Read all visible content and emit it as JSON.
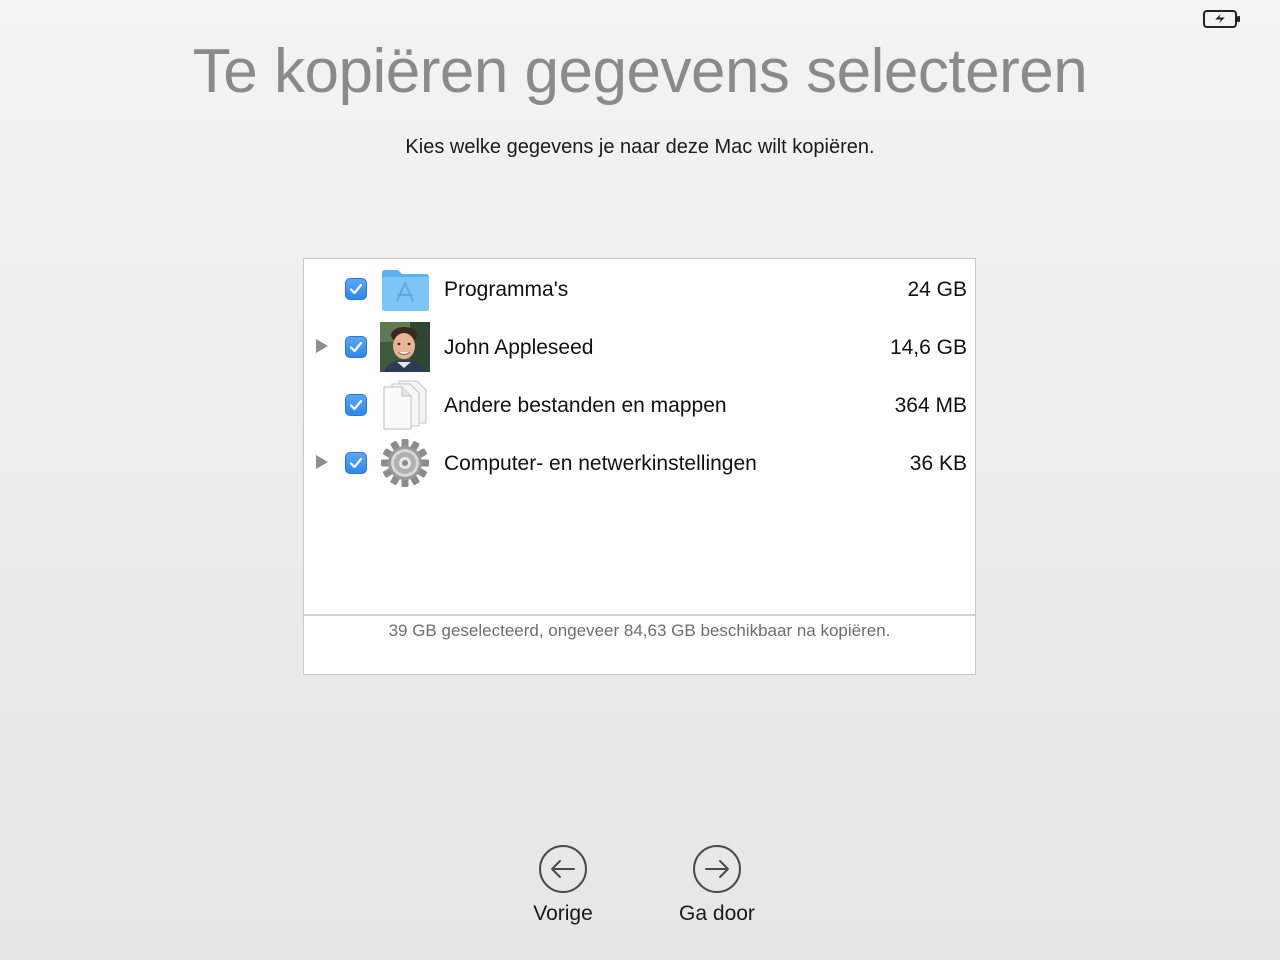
{
  "header": {
    "title": "Te kopiëren gegevens selecteren",
    "subtitle": "Kies welke gegevens je naar deze Mac wilt kopiëren."
  },
  "status_icons": {
    "battery": "battery-charging-icon"
  },
  "items": [
    {
      "label": "Programma's",
      "size": "24 GB",
      "checked": true,
      "expandable": false,
      "icon": "applications-folder-icon"
    },
    {
      "label": "John Appleseed",
      "size": "14,6 GB",
      "checked": true,
      "expandable": true,
      "icon": "user-avatar-icon"
    },
    {
      "label": "Andere bestanden en mappen",
      "size": "364 MB",
      "checked": true,
      "expandable": false,
      "icon": "documents-icon"
    },
    {
      "label": "Computer- en netwerkinstellingen",
      "size": "36 KB",
      "checked": true,
      "expandable": true,
      "icon": "gear-icon"
    }
  ],
  "summary": "39 GB geselecteerd, ongeveer 84,63 GB beschikbaar na kopiëren.",
  "navigation": {
    "back_label": "Vorige",
    "continue_label": "Ga door"
  },
  "colors": {
    "title": "#8a8a8a",
    "checkbox_accent": "#2f87ec",
    "folder_blue": "#6cbcf5"
  }
}
